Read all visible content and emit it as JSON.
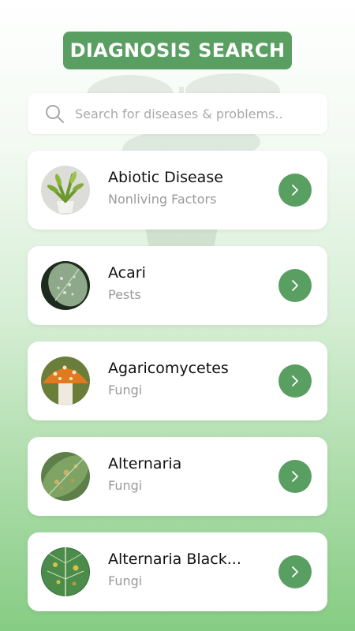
{
  "header": {
    "title": "DIAGNOSIS SEARCH"
  },
  "search": {
    "placeholder": "Search for diseases & problems.."
  },
  "colors": {
    "accent": "#5a9f62",
    "subtitle": "#9a9a9a"
  },
  "items": [
    {
      "title": "Abiotic Disease",
      "subtitle": "Nonliving Factors",
      "icon": "potted-plant-image"
    },
    {
      "title": "Acari",
      "subtitle": "Pests",
      "icon": "mite-damaged-leaf-image"
    },
    {
      "title": "Agaricomycetes",
      "subtitle": "Fungi",
      "icon": "mushroom-image"
    },
    {
      "title": "Alternaria",
      "subtitle": "Fungi",
      "icon": "spotted-leaf-image"
    },
    {
      "title": "Alternaria Black...",
      "subtitle": "Fungi",
      "icon": "blighted-leaf-image"
    }
  ]
}
